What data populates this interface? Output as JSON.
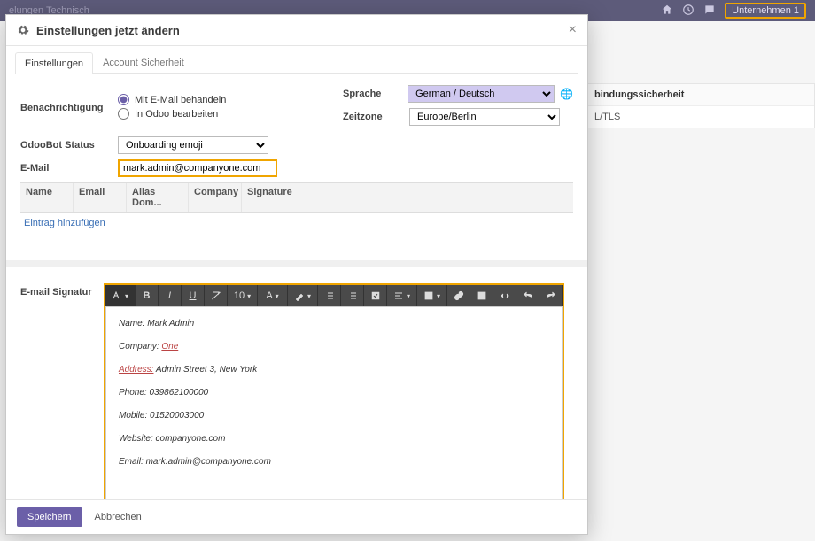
{
  "topbar": {
    "nav": "elungen    Technisch",
    "company": "Unternehmen 1"
  },
  "bg": {
    "header": "bindungssicherheit",
    "value": "L/TLS"
  },
  "modal": {
    "title": "Einstellungen jetzt ändern",
    "tabs": {
      "settings": "Einstellungen",
      "security": "Account Sicherheit"
    },
    "labels": {
      "notification": "Benachrichtigung",
      "odoobot": "OdooBot Status",
      "email": "E-Mail",
      "language": "Sprache",
      "timezone": "Zeitzone",
      "signature": "E-mail Signatur"
    },
    "radio": {
      "by_email": "Mit E-Mail behandeln",
      "in_odoo": "In Odoo bearbeiten"
    },
    "values": {
      "odoobot": "Onboarding emoji",
      "email": "mark.admin@companyone.com",
      "language": "German / Deutsch",
      "timezone": "Europe/Berlin"
    },
    "grid": {
      "cols": {
        "name": "Name",
        "email": "Email",
        "alias": "Alias Dom...",
        "company": "Company",
        "sig": "Signature"
      },
      "add": "Eintrag hinzufügen"
    },
    "toolbar": {
      "size": "10",
      "bold": "B",
      "italic": "I",
      "under": "U",
      "font": "A"
    },
    "signature": {
      "l_name": "Name:",
      "v_name": "Mark Admin",
      "l_company": "Company:",
      "v_company": "One",
      "l_addr": "Address:",
      "v_addr": "Admin Street 3, New York",
      "l_phone": "Phone:",
      "v_phone": "039862100000",
      "l_mobile": "Mobile:",
      "v_mobile": "01520003000",
      "l_web": "Website:",
      "v_web": "companyone.com",
      "l_email": "Email:",
      "v_email": "mark.admin@companyone.com"
    },
    "buttons": {
      "save": "Speichern",
      "cancel": "Abbrechen"
    }
  }
}
